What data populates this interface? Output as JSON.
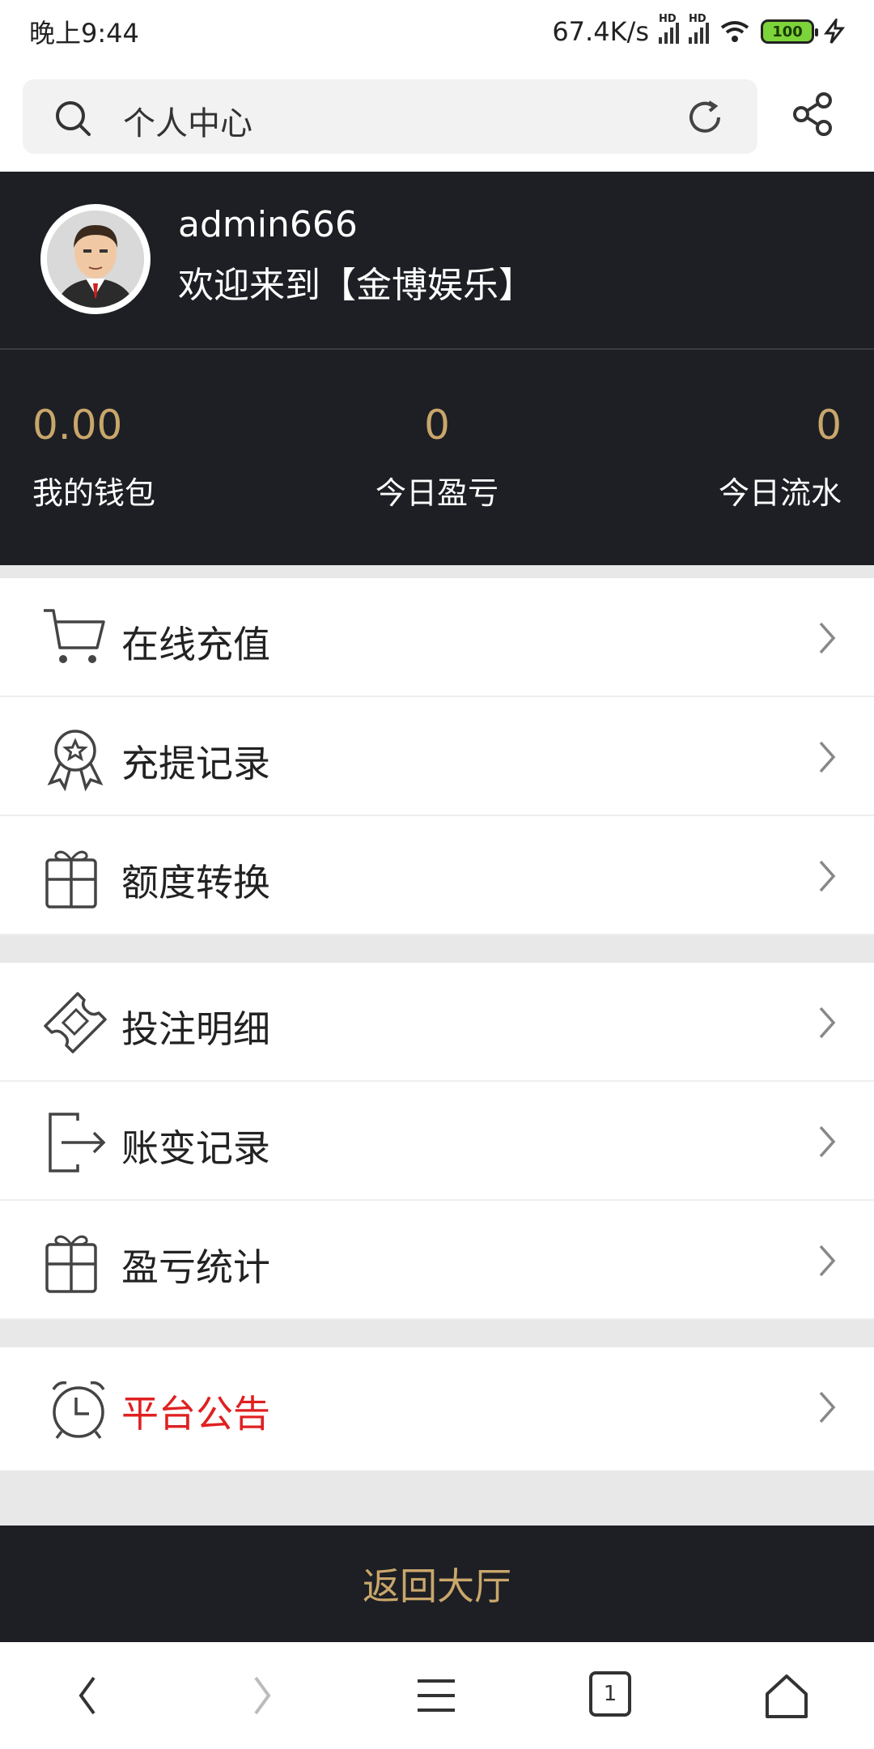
{
  "status_bar": {
    "time": "晚上9:44",
    "net_speed": "67.4K/s",
    "signal_label": "HD",
    "battery": "100"
  },
  "browser": {
    "address": "个人中心"
  },
  "profile": {
    "username": "admin666",
    "welcome": "欢迎来到【金博娱乐】"
  },
  "stats": [
    {
      "value": "0.00",
      "label": "我的钱包"
    },
    {
      "value": "0",
      "label": "今日盈亏"
    },
    {
      "value": "0",
      "label": "今日流水"
    }
  ],
  "menu": [
    {
      "label": "在线充值",
      "icon": "cart-icon"
    },
    {
      "label": "充提记录",
      "icon": "award-icon"
    },
    {
      "label": "额度转换",
      "icon": "gift-icon"
    },
    {
      "label": "投注明细",
      "icon": "ticket-icon"
    },
    {
      "label": "账变记录",
      "icon": "exit-icon"
    },
    {
      "label": "盈亏统计",
      "icon": "gift-icon"
    },
    {
      "label": "平台公告",
      "icon": "alarm-clock-icon"
    }
  ],
  "back_button": "返回大厅",
  "nav": {
    "tab_count": "1"
  },
  "colors": {
    "dark_bg": "#1d1f24",
    "gold": "#c9a66b",
    "alert_red": "#e02020"
  }
}
